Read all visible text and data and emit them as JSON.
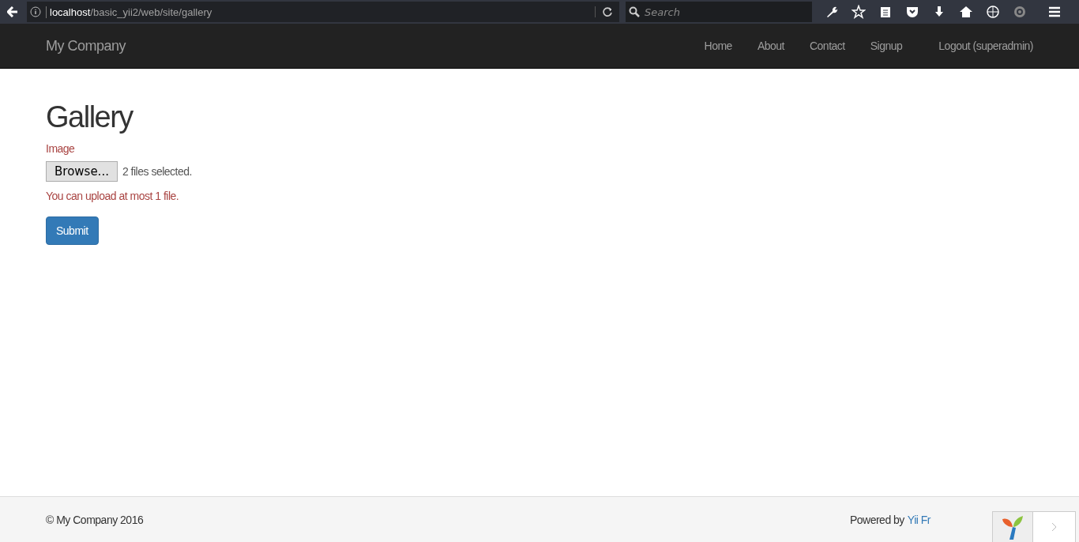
{
  "browser": {
    "url_host": "localhost",
    "url_path": "/basic_yii2/web/site/gallery",
    "search": {
      "placeholder": "Search"
    }
  },
  "navbar": {
    "brand": "My Company",
    "items": [
      "Home",
      "About",
      "Contact",
      "Signup",
      "Logout (superadmin)"
    ]
  },
  "page": {
    "title": "Gallery",
    "field_label": "Image",
    "browse_button": "Browse...",
    "file_status": "2 files selected.",
    "error": "You can upload at most 1 file.",
    "submit": "Submit"
  },
  "footer": {
    "copyright": "© My Company 2016",
    "powered_by": "Powered by",
    "link": "Yii Fr"
  }
}
